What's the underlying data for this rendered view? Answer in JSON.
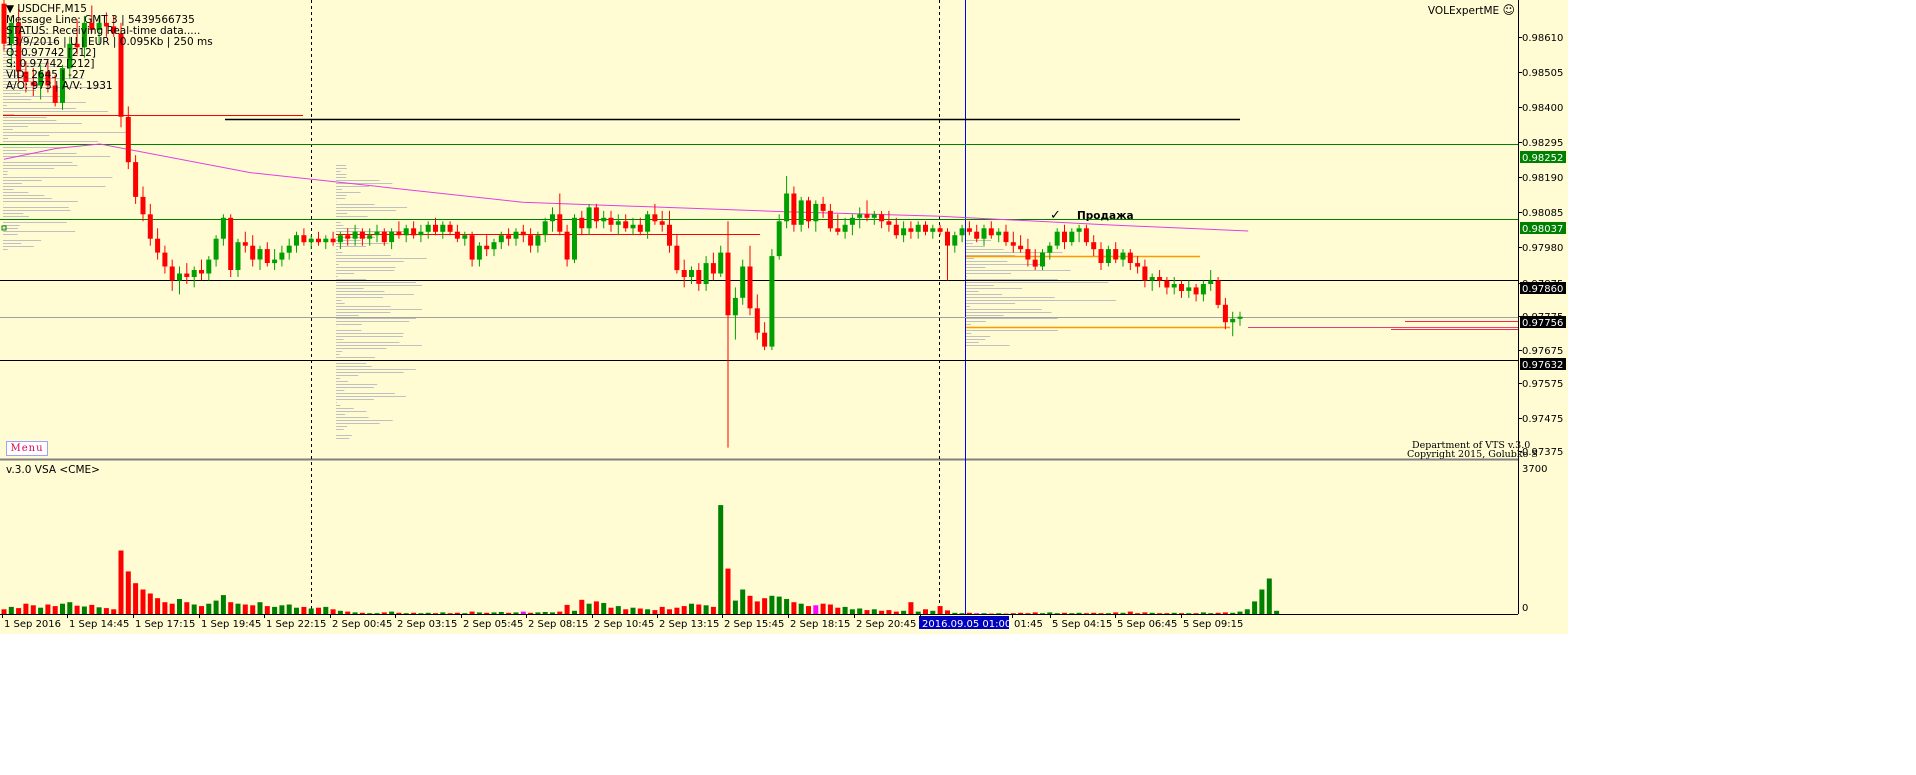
{
  "symbol_title": "USDCHF,M15",
  "info_lines": [
    "Message Line: GMT 3 | 5439566735",
    "STATUS:  Receiving Real-time data.....",
    "13/9/2016 | U | EUR | 0.095Kb | 250 ms",
    "O: 0.97742  [212]",
    "S: 0.97742  [212]",
    "VID: 2645 | -27",
    "A/O: 973 | A/V: 1931"
  ],
  "indicator_name": "VOLExpertME",
  "smiley_icon": "☺",
  "menu_label": "Menu",
  "footer_line1": "Department of VTS  v.3.0",
  "footer_line2": "Copyright 2015, Golubko S",
  "trade_label": "Продажа",
  "trade_mark": "✓",
  "volume_panel_title": "v.3.0 VSA <CME>",
  "volume_scale_top": "3700",
  "volume_scale_bottom": "0",
  "colors": {
    "background": "#fffbd3",
    "bull": "#00a000",
    "bear": "#ff0000",
    "volume_bull": "#008000",
    "volume_bear": "#ff0000",
    "volume_special": "#ff00ff",
    "ma_line": "#e040e0",
    "level_green": "#008000",
    "level_black": "#000000",
    "level_orange": "#ff9900",
    "current_vertical": "#0000ff"
  },
  "chart_data": {
    "type": "candlestick",
    "symbol": "USDCHF",
    "timeframe": "M15",
    "price_ticks": [
      "0.98610",
      "0.98505",
      "0.98400",
      "0.98295",
      "0.98190",
      "0.98085",
      "0.97980",
      "0.97875",
      "0.97775",
      "0.97675",
      "0.97575",
      "0.97475",
      "0.97375"
    ],
    "price_labels_highlighted": [
      "0.98252",
      "0.98037",
      "0.97860",
      "0.97756",
      "0.97632"
    ],
    "time_labels": [
      "1 Sep 2016",
      "1 Sep 14:45",
      "1 Sep 17:15",
      "1 Sep 19:45",
      "1 Sep 22:15",
      "2 Sep 00:45",
      "2 Sep 03:15",
      "2 Sep 05:45",
      "2 Sep 08:15",
      "2 Sep 10:45",
      "2 Sep 13:15",
      "2 Sep 15:45",
      "2 Sep 18:15",
      "2 Sep 20:45",
      "2016.09.05 01:00",
      "01:45",
      "5 Sep 04:15",
      "5 Sep 06:45",
      "5 Sep 09:15"
    ],
    "ohlc": [
      [
        0.98655,
        0.9868,
        0.9852,
        0.9854
      ],
      [
        0.9854,
        0.9862,
        0.9847,
        0.986
      ],
      [
        0.986,
        0.9864,
        0.9843,
        0.9846
      ],
      [
        0.9846,
        0.9849,
        0.984,
        0.9843
      ],
      [
        0.9843,
        0.9847,
        0.9839,
        0.9842
      ],
      [
        0.9842,
        0.9848,
        0.9838,
        0.9846
      ],
      [
        0.9846,
        0.9849,
        0.984,
        0.9842
      ],
      [
        0.9842,
        0.9845,
        0.9836,
        0.9837
      ],
      [
        0.9837,
        0.9848,
        0.9835,
        0.9847
      ],
      [
        0.9847,
        0.9856,
        0.9844,
        0.9854
      ],
      [
        0.9854,
        0.9861,
        0.9851,
        0.9853
      ],
      [
        0.9853,
        0.9862,
        0.985,
        0.986
      ],
      [
        0.986,
        0.9865,
        0.9857,
        0.9858
      ],
      [
        0.9858,
        0.9862,
        0.9854,
        0.986
      ],
      [
        0.986,
        0.9863,
        0.9856,
        0.9859
      ],
      [
        0.9859,
        0.9862,
        0.9856,
        0.9857
      ],
      [
        0.9857,
        0.986,
        0.983,
        0.9833
      ],
      [
        0.9833,
        0.9836,
        0.9818,
        0.982
      ],
      [
        0.982,
        0.9822,
        0.9808,
        0.981
      ],
      [
        0.981,
        0.9813,
        0.9803,
        0.9805
      ],
      [
        0.9805,
        0.9808,
        0.9796,
        0.9798
      ],
      [
        0.9798,
        0.9801,
        0.9792,
        0.9794
      ],
      [
        0.9794,
        0.9796,
        0.9788,
        0.979
      ],
      [
        0.979,
        0.9792,
        0.9783,
        0.9786
      ],
      [
        0.9786,
        0.979,
        0.9782,
        0.9788
      ],
      [
        0.9788,
        0.9791,
        0.9785,
        0.9787
      ],
      [
        0.9787,
        0.979,
        0.9784,
        0.9789
      ],
      [
        0.9789,
        0.9792,
        0.9786,
        0.9788
      ],
      [
        0.9788,
        0.9793,
        0.9786,
        0.9792
      ],
      [
        0.9792,
        0.9799,
        0.979,
        0.9798
      ],
      [
        0.9798,
        0.9805,
        0.9796,
        0.9804
      ],
      [
        0.9804,
        0.9805,
        0.9787,
        0.9789
      ],
      [
        0.9789,
        0.9798,
        0.9787,
        0.9797
      ],
      [
        0.9797,
        0.98,
        0.9794,
        0.9796
      ],
      [
        0.9796,
        0.9799,
        0.979,
        0.9792
      ],
      [
        0.9792,
        0.9796,
        0.9789,
        0.9795
      ],
      [
        0.9795,
        0.9797,
        0.979,
        0.9791
      ],
      [
        0.9791,
        0.9795,
        0.9789,
        0.9792
      ],
      [
        0.9792,
        0.9796,
        0.979,
        0.9794
      ],
      [
        0.9794,
        0.9798,
        0.9792,
        0.9796
      ],
      [
        0.9796,
        0.98,
        0.9794,
        0.9799
      ],
      [
        0.9799,
        0.9801,
        0.9796,
        0.9797
      ],
      [
        0.9797,
        0.9799,
        0.9795,
        0.9798
      ],
      [
        0.9798,
        0.98,
        0.9796,
        0.9797
      ],
      [
        0.9797,
        0.9799,
        0.9795,
        0.9798
      ],
      [
        0.9798,
        0.98,
        0.9796,
        0.9797
      ],
      [
        0.9797,
        0.98,
        0.9795,
        0.9799
      ],
      [
        0.9799,
        0.9801,
        0.9796,
        0.9798
      ],
      [
        0.9798,
        0.9802,
        0.9796,
        0.98
      ],
      [
        0.98,
        0.9801,
        0.9796,
        0.9798
      ],
      [
        0.9798,
        0.9801,
        0.9796,
        0.9799
      ],
      [
        0.9799,
        0.9802,
        0.9797,
        0.98
      ],
      [
        0.98,
        0.9801,
        0.9796,
        0.9797
      ],
      [
        0.9797,
        0.9801,
        0.9795,
        0.98
      ],
      [
        0.98,
        0.9803,
        0.9798,
        0.9799
      ],
      [
        0.9799,
        0.9802,
        0.9797,
        0.9801
      ],
      [
        0.9801,
        0.9803,
        0.9798,
        0.9799
      ],
      [
        0.9799,
        0.9802,
        0.9797,
        0.98
      ],
      [
        0.98,
        0.9803,
        0.9798,
        0.9802
      ],
      [
        0.9802,
        0.9804,
        0.9799,
        0.98
      ],
      [
        0.98,
        0.9803,
        0.9798,
        0.9802
      ],
      [
        0.9802,
        0.9803,
        0.9799,
        0.98
      ],
      [
        0.98,
        0.9802,
        0.9797,
        0.9798
      ],
      [
        0.9798,
        0.98,
        0.9796,
        0.9799
      ],
      [
        0.9799,
        0.98,
        0.979,
        0.9792
      ],
      [
        0.9792,
        0.9797,
        0.979,
        0.9796
      ],
      [
        0.9796,
        0.9799,
        0.9793,
        0.9795
      ],
      [
        0.9795,
        0.9798,
        0.9793,
        0.9797
      ],
      [
        0.9797,
        0.98,
        0.9795,
        0.9799
      ],
      [
        0.9799,
        0.9801,
        0.9796,
        0.9798
      ],
      [
        0.9798,
        0.9801,
        0.9796,
        0.98
      ],
      [
        0.98,
        0.9802,
        0.9797,
        0.9799
      ],
      [
        0.9799,
        0.9801,
        0.9794,
        0.9796
      ],
      [
        0.9796,
        0.98,
        0.9794,
        0.9799
      ],
      [
        0.9799,
        0.9804,
        0.9797,
        0.9803
      ],
      [
        0.9803,
        0.9807,
        0.98,
        0.9805
      ],
      [
        0.9805,
        0.9811,
        0.9799,
        0.98
      ],
      [
        0.98,
        0.9802,
        0.979,
        0.9792
      ],
      [
        0.9792,
        0.9805,
        0.9791,
        0.9804
      ],
      [
        0.9804,
        0.9806,
        0.9799,
        0.9801
      ],
      [
        0.9801,
        0.9808,
        0.9799,
        0.9807
      ],
      [
        0.9807,
        0.9808,
        0.9801,
        0.9803
      ],
      [
        0.9803,
        0.9806,
        0.9801,
        0.9804
      ],
      [
        0.9804,
        0.9806,
        0.98,
        0.9802
      ],
      [
        0.9802,
        0.9805,
        0.9799,
        0.9803
      ],
      [
        0.9803,
        0.9805,
        0.98,
        0.9801
      ],
      [
        0.9801,
        0.9804,
        0.9799,
        0.9802
      ],
      [
        0.9802,
        0.9804,
        0.9799,
        0.98
      ],
      [
        0.98,
        0.9806,
        0.9798,
        0.9805
      ],
      [
        0.9805,
        0.9808,
        0.9802,
        0.9803
      ],
      [
        0.9803,
        0.9806,
        0.98,
        0.9802
      ],
      [
        0.9802,
        0.9806,
        0.9794,
        0.9796
      ],
      [
        0.9796,
        0.9799,
        0.9788,
        0.9789
      ],
      [
        0.9789,
        0.9792,
        0.9784,
        0.9787
      ],
      [
        0.9787,
        0.979,
        0.9785,
        0.9789
      ],
      [
        0.9789,
        0.9791,
        0.9783,
        0.9785
      ],
      [
        0.9785,
        0.9793,
        0.9783,
        0.9791
      ],
      [
        0.9791,
        0.9794,
        0.9786,
        0.9788
      ],
      [
        0.9788,
        0.9796,
        0.9787,
        0.9794
      ],
      [
        0.9794,
        0.9803,
        0.9738,
        0.9776
      ],
      [
        0.9776,
        0.9784,
        0.9769,
        0.9781
      ],
      [
        0.9781,
        0.9792,
        0.9779,
        0.979
      ],
      [
        0.979,
        0.9796,
        0.9776,
        0.9778
      ],
      [
        0.9778,
        0.9782,
        0.9769,
        0.9771
      ],
      [
        0.9771,
        0.9774,
        0.9766,
        0.9767
      ],
      [
        0.9767,
        0.9795,
        0.9766,
        0.9793
      ],
      [
        0.9793,
        0.9805,
        0.9792,
        0.9803
      ],
      [
        0.9803,
        0.9816,
        0.9801,
        0.9811
      ],
      [
        0.9811,
        0.9813,
        0.98,
        0.9802
      ],
      [
        0.9802,
        0.981,
        0.98,
        0.9809
      ],
      [
        0.9809,
        0.981,
        0.9801,
        0.9803
      ],
      [
        0.9803,
        0.9809,
        0.98,
        0.9808
      ],
      [
        0.9808,
        0.981,
        0.9804,
        0.9806
      ],
      [
        0.9806,
        0.9808,
        0.98,
        0.9801
      ],
      [
        0.9801,
        0.9805,
        0.9799,
        0.98
      ],
      [
        0.98,
        0.9804,
        0.9798,
        0.9802
      ],
      [
        0.9802,
        0.9805,
        0.9799,
        0.9804
      ],
      [
        0.9804,
        0.9807,
        0.9801,
        0.9805
      ],
      [
        0.9805,
        0.9809,
        0.9803,
        0.9804
      ],
      [
        0.9804,
        0.9806,
        0.9802,
        0.9805
      ],
      [
        0.9805,
        0.9806,
        0.9801,
        0.9803
      ],
      [
        0.9803,
        0.9806,
        0.98,
        0.9802
      ],
      [
        0.9802,
        0.9804,
        0.9798,
        0.9799
      ],
      [
        0.9799,
        0.9803,
        0.9797,
        0.9801
      ],
      [
        0.9801,
        0.9803,
        0.9798,
        0.98
      ],
      [
        0.98,
        0.9803,
        0.9798,
        0.9802
      ],
      [
        0.9802,
        0.9803,
        0.9799,
        0.98
      ],
      [
        0.98,
        0.9802,
        0.9798,
        0.9801
      ],
      [
        0.9801,
        0.9802,
        0.9799,
        0.98
      ],
      [
        0.98,
        0.9801,
        0.9786,
        0.9796
      ],
      [
        0.9796,
        0.98,
        0.9794,
        0.9799
      ],
      [
        0.9799,
        0.9802,
        0.9797,
        0.9801
      ],
      [
        0.9801,
        0.9803,
        0.9799,
        0.98
      ],
      [
        0.98,
        0.9802,
        0.9797,
        0.9798
      ],
      [
        0.9798,
        0.9802,
        0.9796,
        0.9801
      ],
      [
        0.9801,
        0.9803,
        0.9798,
        0.9799
      ],
      [
        0.9799,
        0.9801,
        0.9797,
        0.98
      ],
      [
        0.98,
        0.9802,
        0.9796,
        0.9797
      ],
      [
        0.9797,
        0.98,
        0.9794,
        0.9796
      ],
      [
        0.9796,
        0.9799,
        0.9794,
        0.9795
      ],
      [
        0.9795,
        0.9798,
        0.979,
        0.9792
      ],
      [
        0.9792,
        0.9795,
        0.9789,
        0.979
      ],
      [
        0.979,
        0.9795,
        0.9789,
        0.9794
      ],
      [
        0.9794,
        0.9797,
        0.9792,
        0.9796
      ],
      [
        0.9796,
        0.9801,
        0.9795,
        0.98
      ],
      [
        0.98,
        0.9802,
        0.9795,
        0.9797
      ],
      [
        0.9797,
        0.9801,
        0.9796,
        0.98
      ],
      [
        0.98,
        0.9802,
        0.9797,
        0.9801
      ],
      [
        0.9801,
        0.9802,
        0.9796,
        0.9797
      ],
      [
        0.9797,
        0.9799,
        0.9793,
        0.9795
      ],
      [
        0.9795,
        0.9797,
        0.9789,
        0.9791
      ],
      [
        0.9791,
        0.9796,
        0.979,
        0.9795
      ],
      [
        0.9795,
        0.9797,
        0.9791,
        0.9792
      ],
      [
        0.9792,
        0.9795,
        0.979,
        0.9794
      ],
      [
        0.9794,
        0.9795,
        0.9789,
        0.9791
      ],
      [
        0.9791,
        0.9793,
        0.9788,
        0.979
      ],
      [
        0.979,
        0.9792,
        0.9784,
        0.9786
      ],
      [
        0.9786,
        0.9788,
        0.9783,
        0.9787
      ],
      [
        0.9787,
        0.9789,
        0.9784,
        0.9786
      ],
      [
        0.9786,
        0.9787,
        0.9782,
        0.9784
      ],
      [
        0.9784,
        0.9787,
        0.9782,
        0.9785
      ],
      [
        0.9785,
        0.9786,
        0.9781,
        0.9783
      ],
      [
        0.9783,
        0.9786,
        0.9781,
        0.9784
      ],
      [
        0.9784,
        0.9785,
        0.978,
        0.9782
      ],
      [
        0.9782,
        0.9786,
        0.978,
        0.9785
      ],
      [
        0.9785,
        0.9789,
        0.9783,
        0.9786
      ],
      [
        0.9786,
        0.9787,
        0.9778,
        0.9779
      ],
      [
        0.9779,
        0.9781,
        0.9772,
        0.9774
      ],
      [
        0.9774,
        0.9777,
        0.977,
        0.9775
      ],
      [
        0.9775,
        0.9777,
        0.9773,
        0.97756
      ]
    ],
    "volume": [
      120,
      180,
      150,
      260,
      220,
      160,
      240,
      200,
      260,
      300,
      210,
      190,
      230,
      170,
      150,
      120,
      1610,
      1080,
      780,
      620,
      520,
      400,
      300,
      260,
      380,
      300,
      240,
      200,
      260,
      340,
      480,
      300,
      260,
      240,
      220,
      300,
      200,
      180,
      220,
      240,
      160,
      180,
      140,
      160,
      180,
      120,
      80,
      60,
      40,
      30,
      20,
      20,
      40,
      60,
      30,
      20,
      30,
      20,
      30,
      20,
      40,
      20,
      30,
      20,
      60,
      40,
      30,
      40,
      50,
      30,
      40,
      60,
      30,
      40,
      50,
      40,
      60,
      230,
      80,
      360,
      260,
      320,
      280,
      160,
      200,
      120,
      160,
      140,
      120,
      100,
      180,
      120,
      160,
      200,
      260,
      240,
      220,
      180,
      2760,
      1150,
      340,
      620,
      460,
      320,
      400,
      460,
      440,
      380,
      300,
      260,
      200,
      220,
      260,
      240,
      160,
      180,
      120,
      140,
      100,
      120,
      80,
      100,
      60,
      80,
      300,
      60,
      120,
      80,
      200,
      90,
      30,
      20,
      30,
      20,
      20,
      10,
      20,
      10,
      20,
      30,
      20,
      40,
      20,
      40,
      20,
      30,
      20,
      30,
      20,
      30,
      20,
      20,
      40,
      30,
      60,
      20,
      40,
      30,
      20,
      20,
      30,
      20,
      20,
      20,
      40,
      20,
      30,
      40,
      30,
      60,
      120,
      320,
      620,
      900,
      80
    ],
    "volume_special_bars": [
      71,
      111,
      133
    ],
    "ma_points": [
      [
        0,
        0.98208
      ],
      [
        40,
        0.98239
      ],
      [
        74,
        0.98252
      ],
      [
        190,
        0.9817
      ],
      [
        400,
        0.98085
      ],
      [
        600,
        0.98058
      ],
      [
        720,
        0.98045
      ],
      [
        850,
        0.9802
      ],
      [
        960,
        0.98002
      ]
    ],
    "levels": [
      {
        "price": 0.98252,
        "color": "green"
      },
      {
        "price": 0.98037,
        "color": "green"
      },
      {
        "price": 0.9786,
        "color": "black"
      },
      {
        "price": 0.97756,
        "color": "gray"
      },
      {
        "price": 0.97632,
        "color": "black"
      },
      {
        "price": 0.98325,
        "color": "black",
        "partial": true
      }
    ],
    "price_range": [
      0.9735,
      0.9866
    ],
    "volume_range": [
      0,
      3700
    ]
  }
}
